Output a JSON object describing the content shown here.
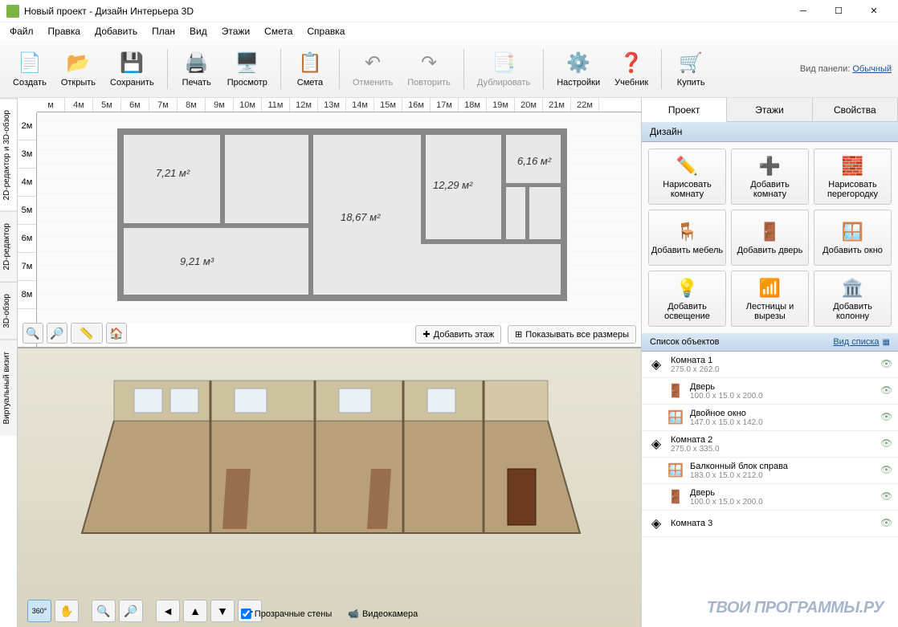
{
  "window": {
    "title": "Новый проект - Дизайн Интерьера 3D"
  },
  "menu": [
    "Файл",
    "Правка",
    "Добавить",
    "План",
    "Вид",
    "Этажи",
    "Смета",
    "Справка"
  ],
  "toolbar": [
    {
      "label": "Создать",
      "icon": "📄"
    },
    {
      "label": "Открыть",
      "icon": "📂"
    },
    {
      "label": "Сохранить",
      "icon": "💾"
    },
    {
      "sep": true
    },
    {
      "label": "Печать",
      "icon": "🖨️"
    },
    {
      "label": "Просмотр",
      "icon": "🖥️"
    },
    {
      "sep": true
    },
    {
      "label": "Смета",
      "icon": "📋"
    },
    {
      "sep": true
    },
    {
      "label": "Отменить",
      "icon": "↶",
      "disabled": true
    },
    {
      "label": "Повторить",
      "icon": "↷",
      "disabled": true
    },
    {
      "sep": true
    },
    {
      "label": "Дублировать",
      "icon": "📑",
      "disabled": true
    },
    {
      "sep": true
    },
    {
      "label": "Настройки",
      "icon": "⚙️"
    },
    {
      "label": "Учебник",
      "icon": "❓"
    },
    {
      "sep": true
    },
    {
      "label": "Купить",
      "icon": "🛒"
    }
  ],
  "panel_mode": {
    "label": "Вид панели:",
    "value": "Обычный"
  },
  "vtabs": [
    "2D-редактор и 3D-обзор",
    "2D-редактор",
    "3D-обзор",
    "Виртуальный визит"
  ],
  "ruler_h": [
    "м",
    "4м",
    "5м",
    "6м",
    "7м",
    "8м",
    "9м",
    "10м",
    "11м",
    "12м",
    "13м",
    "14м",
    "15м",
    "16м",
    "17м",
    "18м",
    "19м",
    "20м",
    "21м",
    "22м"
  ],
  "ruler_v": [
    "2м",
    "3м",
    "4м",
    "5м",
    "6м",
    "7м",
    "8м"
  ],
  "rooms": [
    {
      "area": "7,21 м²"
    },
    {
      "area": "18,67 м²"
    },
    {
      "area": "12,29 м²"
    },
    {
      "area": "6,16 м²"
    },
    {
      "area": "9,21 м³"
    }
  ],
  "plan_actions": {
    "add_floor": "Добавить этаж",
    "show_dims": "Показывать все размеры"
  },
  "view3d_checks": {
    "transparent": "Прозрачные стены",
    "camera": "Видеокамера"
  },
  "rtabs": [
    "Проект",
    "Этажи",
    "Свойства"
  ],
  "sections": {
    "design": "Дизайн",
    "objects": "Список объектов",
    "list_mode": "Вид списка"
  },
  "design_buttons": [
    {
      "label": "Нарисовать комнату",
      "icon": "✏️"
    },
    {
      "label": "Добавить комнату",
      "icon": "➕"
    },
    {
      "label": "Нарисовать перегородку",
      "icon": "🧱"
    },
    {
      "label": "Добавить мебель",
      "icon": "🪑"
    },
    {
      "label": "Добавить дверь",
      "icon": "🚪"
    },
    {
      "label": "Добавить окно",
      "icon": "🪟"
    },
    {
      "label": "Добавить освещение",
      "icon": "💡"
    },
    {
      "label": "Лестницы и вырезы",
      "icon": "📶"
    },
    {
      "label": "Добавить колонну",
      "icon": "🏛️"
    }
  ],
  "objects": [
    {
      "name": "Комната 1",
      "dims": "275.0 x 262.0",
      "icon": "◈",
      "indent": 0
    },
    {
      "name": "Дверь",
      "dims": "100.0 x 15.0 x 200.0",
      "icon": "🚪",
      "indent": 1
    },
    {
      "name": "Двойное окно",
      "dims": "147.0 x 15.0 x 142.0",
      "icon": "🪟",
      "indent": 1
    },
    {
      "name": "Комната 2",
      "dims": "275.0 x 335.0",
      "icon": "◈",
      "indent": 0
    },
    {
      "name": "Балконный блок справа",
      "dims": "183.0 x 15.0 x 212.0",
      "icon": "🪟",
      "indent": 1
    },
    {
      "name": "Дверь",
      "dims": "100.0 x 15.0 x 200.0",
      "icon": "🚪",
      "indent": 1
    },
    {
      "name": "Комната 3",
      "dims": "",
      "icon": "◈",
      "indent": 0
    }
  ],
  "watermark": "ТВОИ ПРОГРАММЫ.РУ"
}
